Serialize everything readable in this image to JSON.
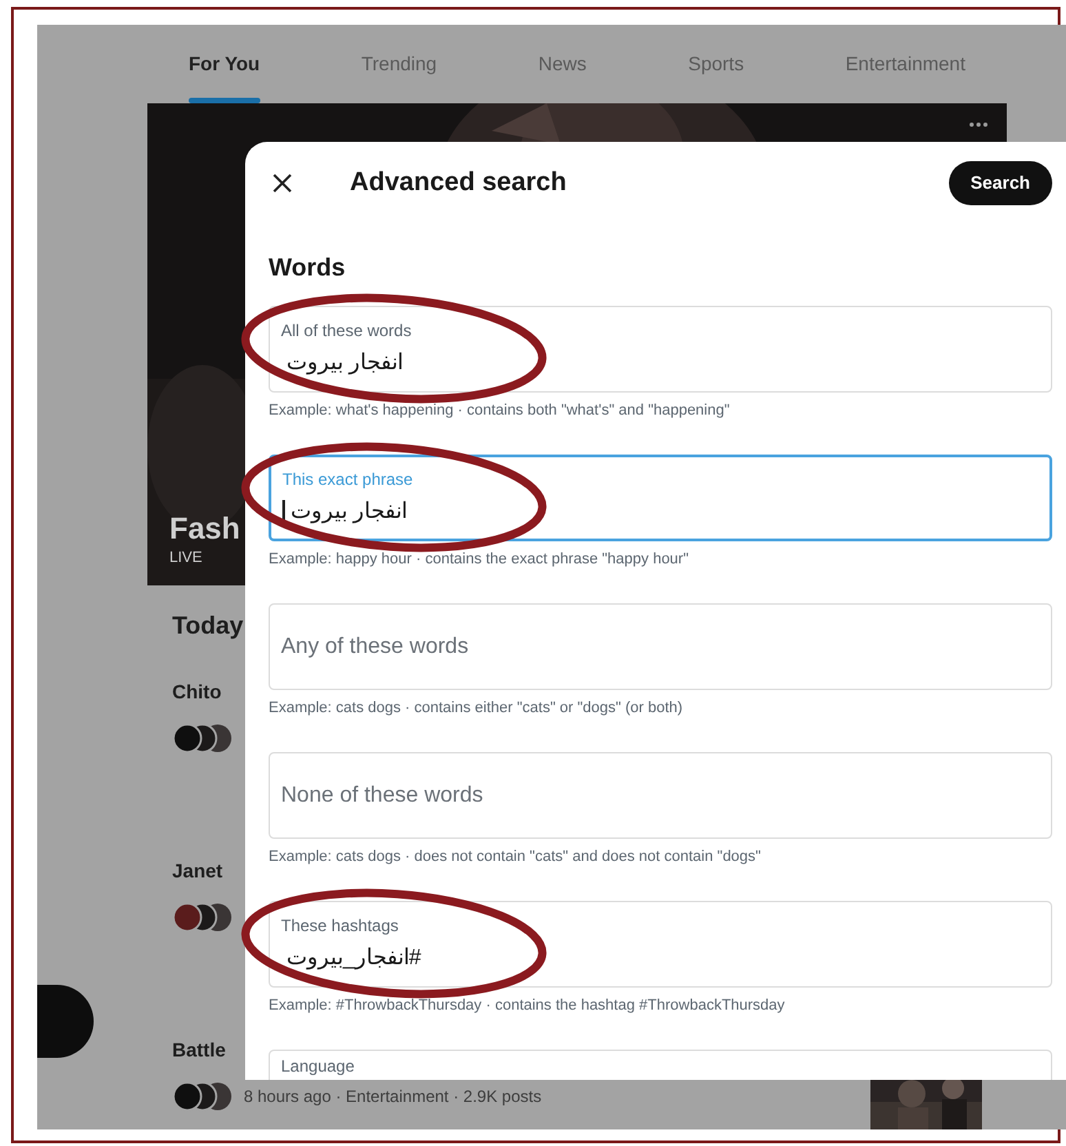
{
  "explore": {
    "tabs": [
      {
        "label": "For You",
        "selected": true
      },
      {
        "label": "Trending",
        "selected": false
      },
      {
        "label": "News",
        "selected": false
      },
      {
        "label": "Sports",
        "selected": false
      },
      {
        "label": "Entertainment",
        "selected": false
      }
    ],
    "hero": {
      "kind": "picture",
      "title": "Fash",
      "badge": "LIVE"
    },
    "section_title": "Today",
    "trends": [
      {
        "title": "Chito"
      },
      {
        "title": "Janet"
      },
      {
        "title": "Battle",
        "meta": "8 hours ago · Entertainment · 2.9K posts"
      }
    ]
  },
  "dialog": {
    "title": "Advanced search",
    "search_button": "Search",
    "section": "Words",
    "fields": [
      {
        "label": "All of these words",
        "value": "انفجار بيروت",
        "focused": false,
        "circled": true,
        "example": "Example: what's happening · contains both \"what's\" and \"happening\""
      },
      {
        "label": "This exact phrase",
        "value": "انفجار بيروت",
        "focused": true,
        "circled": true,
        "example": "Example: happy hour · contains the exact phrase \"happy hour\""
      },
      {
        "placeholder": "Any of these words",
        "focused": false,
        "circled": false,
        "example": "Example: cats dogs · contains either \"cats\" or \"dogs\" (or both)"
      },
      {
        "placeholder": "None of these words",
        "focused": false,
        "circled": false,
        "example": "Example: cats dogs · does not contain \"cats\" and does not contain \"dogs\""
      },
      {
        "label": "These hashtags",
        "value": "#انفجار_بيروت",
        "focused": false,
        "circled": true,
        "example": "Example: #ThrowbackThursday · contains the hashtag #ThrowbackThursday"
      },
      {
        "label": "Language",
        "focused": false,
        "circled": false
      }
    ]
  }
}
